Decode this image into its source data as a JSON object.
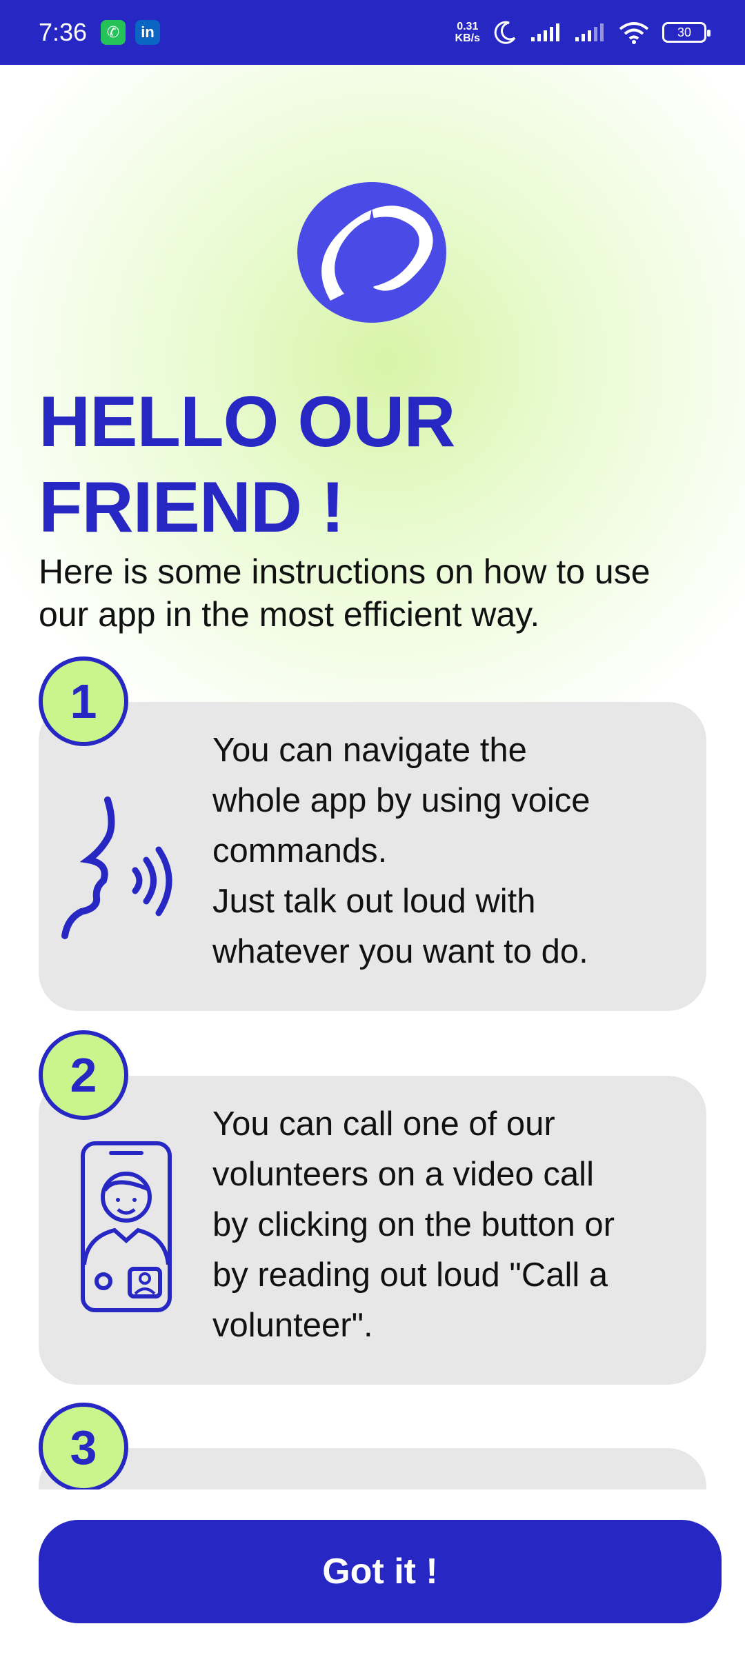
{
  "status_bar": {
    "time": "7:36",
    "net_speed_value": "0.31",
    "net_speed_unit": "KB/s",
    "battery": "30"
  },
  "header": {
    "title_line1": "HELLO OUR",
    "title_line2": "FRIEND !",
    "intro": "Here is some instructions on how to use our app in the most efficient way."
  },
  "steps": [
    {
      "number": "1",
      "icon": "voice-command-icon",
      "text_lines": [
        "You can navigate the",
        "whole app by using voice",
        "commands.",
        "Just talk out loud with",
        "whatever you want to do."
      ]
    },
    {
      "number": "2",
      "icon": "video-call-icon",
      "text_lines": [
        "You can call one of our",
        "volunteers on a video call",
        "by clicking on the button or",
        "by reading out loud \"Call a",
        "volunteer\"."
      ]
    },
    {
      "number": "3",
      "icon": "",
      "text_lines": []
    }
  ],
  "button": {
    "label": "Got it !"
  },
  "colors": {
    "primary": "#2727c4",
    "accent": "#caf48c",
    "card": "#e7e7e7"
  }
}
